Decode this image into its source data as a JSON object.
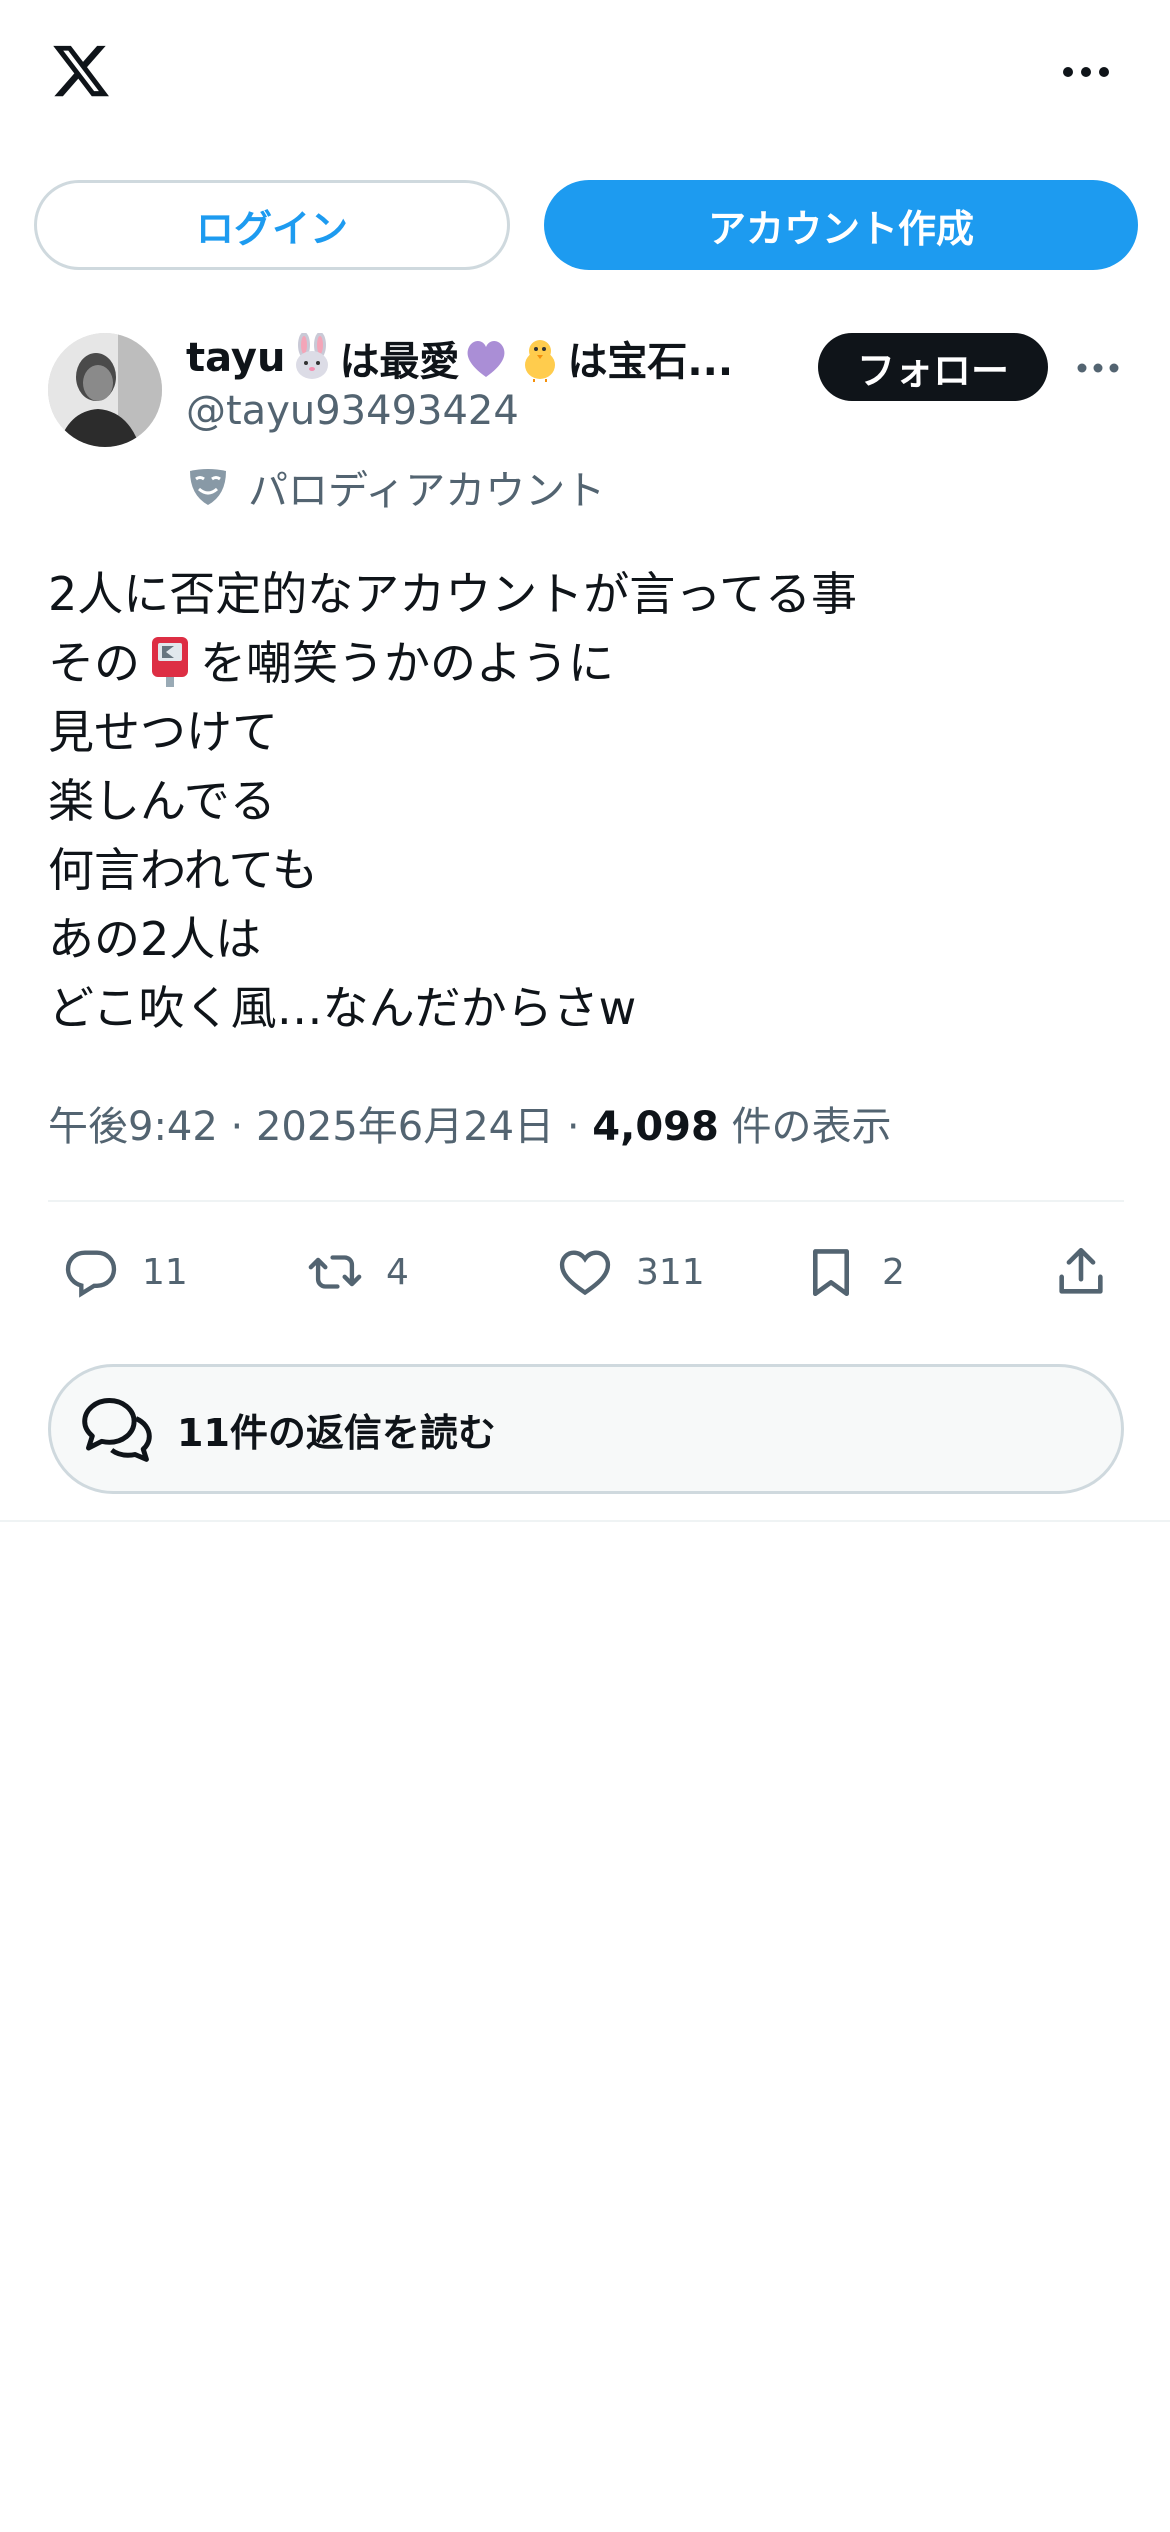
{
  "header": {
    "logo_icon": "x-logo-icon",
    "more_icon": "more-horizontal-icon"
  },
  "auth": {
    "login_label": "ログイン",
    "signup_label": "アカウント作成"
  },
  "tweet": {
    "author": {
      "name_prefix": "tayu",
      "name_part2": "は最愛",
      "name_part3": "は宝石...",
      "name_emojis": [
        "rabbit-emoji",
        "purple-heart-emoji",
        "chick-emoji"
      ],
      "handle": "@tayu93493424",
      "parody_label": "パロディアカウント"
    },
    "follow_label": "フォロー",
    "text_lines": [
      "2人に否定的なアカウントが言ってる事",
      "を嘲笑うかのように",
      "見せつけて",
      "楽しんでる",
      "何言われても",
      "あの2人は",
      "どこ吹く風…なんだからさw"
    ],
    "text_line2_prefix": "その",
    "meta": {
      "time": "午後9:42",
      "sep": "·",
      "date": "2025年6月24日",
      "views_count": "4,098",
      "views_label": "件の表示"
    },
    "actions": {
      "replies": "11",
      "retweets": "4",
      "likes": "311",
      "bookmarks": "2"
    },
    "read_replies_label": "11件の返信を読む"
  },
  "colors": {
    "accent": "#1d9bf0",
    "text": "#0f1419",
    "secondary": "#536471",
    "border": "#cfd9de"
  }
}
